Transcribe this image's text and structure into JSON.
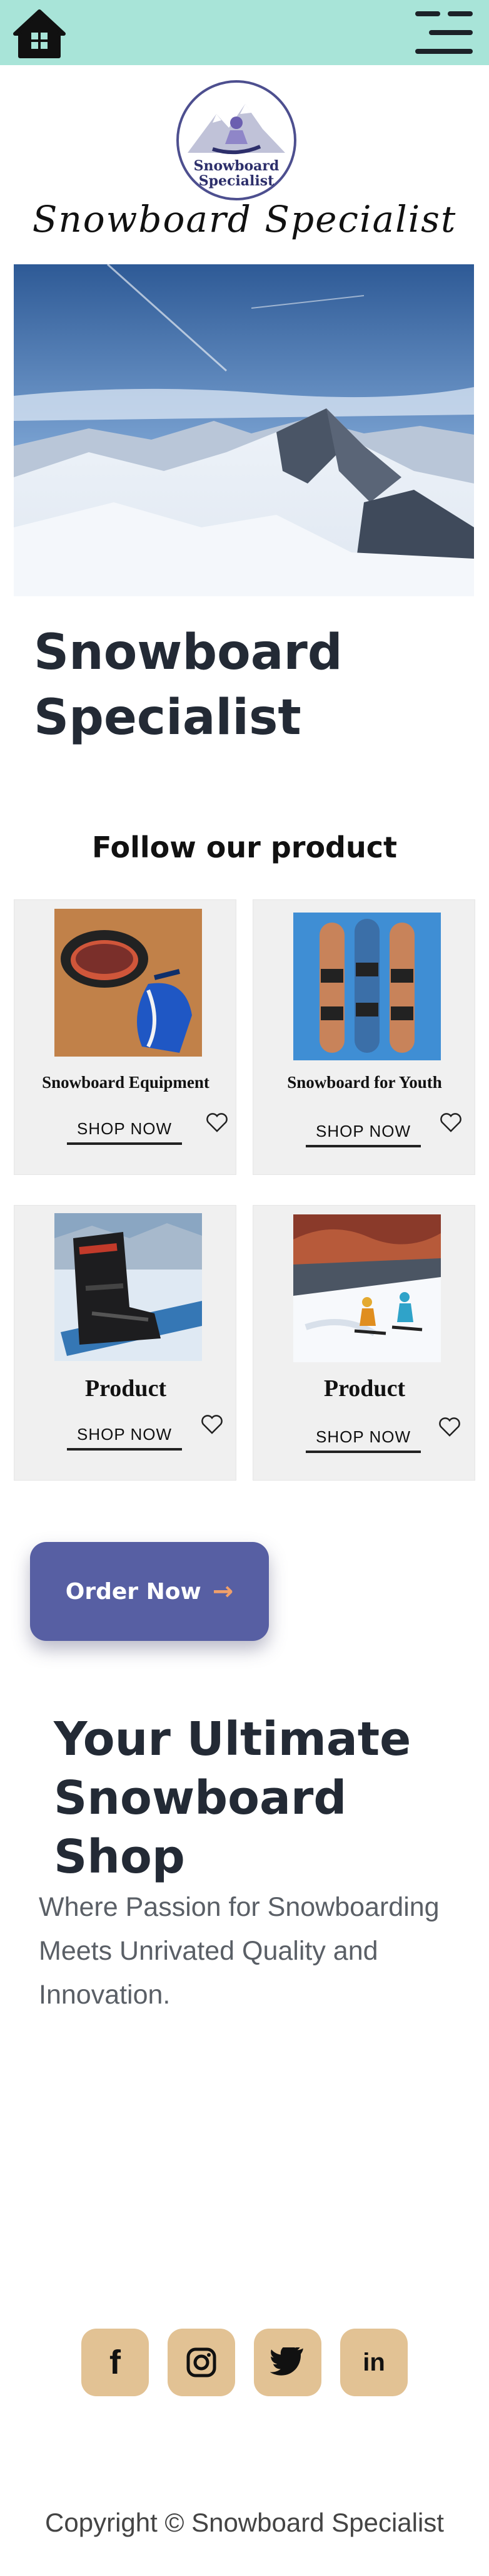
{
  "header": {
    "home_icon": "home-icon",
    "menu_icon": "menu-icon"
  },
  "logo": {
    "line1": "Snowboard",
    "line2": "Specialist"
  },
  "brand_name": "Snowboard Specialist",
  "hero": {
    "title_line1": "Snowboard",
    "title_line2": "Specialist"
  },
  "products_section": {
    "title": "Follow our product",
    "cards": [
      {
        "name": "Snowboard Equipment",
        "cta": "SHOP NOW"
      },
      {
        "name": "Snowboard for Youth",
        "cta": "SHOP NOW"
      },
      {
        "name": "Product",
        "cta": "SHOP NOW"
      },
      {
        "name": "Product",
        "cta": "SHOP NOW"
      }
    ]
  },
  "order": {
    "label": "Order Now",
    "arrow": "→"
  },
  "intro": {
    "title_line1": "Your Ultimate",
    "title_line2": "Snowboard Shop",
    "tagline": "Where Passion for Snowboarding Meets Unrivated Quality and Innovation."
  },
  "social": {
    "facebook": "f",
    "twitter_icon": "twitter-icon",
    "instagram_icon": "instagram-icon",
    "linkedin": "in"
  },
  "footer": {
    "copyright": "Copyright © Snowboard Specialist"
  },
  "colors": {
    "topbar": "#a8e4d8",
    "order_button": "#575fa3",
    "social_tile": "#e2c294",
    "card_bg": "#f0f0f0",
    "heading": "#232a35"
  }
}
